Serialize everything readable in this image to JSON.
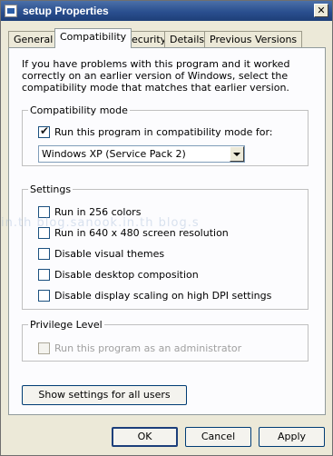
{
  "window": {
    "title": "setup Properties",
    "close_glyph": "✕"
  },
  "tabs": [
    {
      "label": "General"
    },
    {
      "label": "Compatibility"
    },
    {
      "label": "Security"
    },
    {
      "label": "Details"
    },
    {
      "label": "Previous Versions"
    }
  ],
  "active_tab": "Compatibility",
  "intro_text": "If you have problems with this program and it worked correctly on an earlier version of Windows, select the compatibility mode that matches that earlier version.",
  "compat_mode": {
    "legend": "Compatibility mode",
    "checkbox_label": "Run this program in compatibility mode for:",
    "checked": true,
    "selected_os": "Windows XP (Service Pack 2)"
  },
  "settings": {
    "legend": "Settings",
    "items": [
      {
        "label": "Run in 256 colors",
        "checked": false
      },
      {
        "label": "Run in 640 x 480 screen resolution",
        "checked": false
      },
      {
        "label": "Disable visual themes",
        "checked": false
      },
      {
        "label": "Disable desktop composition",
        "checked": false
      },
      {
        "label": "Disable display scaling on high DPI settings",
        "checked": false
      }
    ]
  },
  "privilege": {
    "legend": "Privilege Level",
    "checkbox_label": "Run this program as an administrator",
    "checked": false,
    "disabled": true
  },
  "show_all_users_button": "Show settings for all users",
  "footer": {
    "ok": "OK",
    "cancel": "Cancel",
    "apply": "Apply"
  },
  "watermark": "in.th   blog.sanook.in.th   blog.s"
}
